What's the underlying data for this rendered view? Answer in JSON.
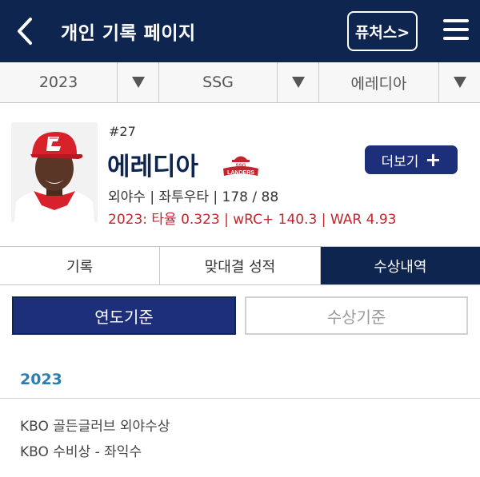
{
  "header": {
    "title": "개인 기록 페이지",
    "futures_label": "퓨처스>"
  },
  "filters": [
    {
      "value": "2023"
    },
    {
      "value": "SSG"
    },
    {
      "value": "에레디아"
    }
  ],
  "player": {
    "number": "#27",
    "name": "에레디아",
    "team_logo_text": "SSG LANDERS",
    "more_label": "더보기",
    "info": "외야수 | 좌투우타 | 178 / 88",
    "season_stats": "2023: 타율 0.323 | wRC+ 140.3 | WAR 4.93"
  },
  "tabs": [
    {
      "label": "기록"
    },
    {
      "label": "맞대결 성적"
    },
    {
      "label": "수상내역"
    }
  ],
  "subtabs": [
    {
      "label": "연도기준"
    },
    {
      "label": "수상기준"
    }
  ],
  "awards": {
    "year": "2023",
    "items": [
      "KBO 골든글러브 외야수상",
      "KBO 수비상 - 좌익수"
    ]
  },
  "colors": {
    "header_bg": "#0e2550",
    "button_bg": "#1d2e7a",
    "stats_red": "#c0272d",
    "year_blue": "#2a7fae"
  }
}
